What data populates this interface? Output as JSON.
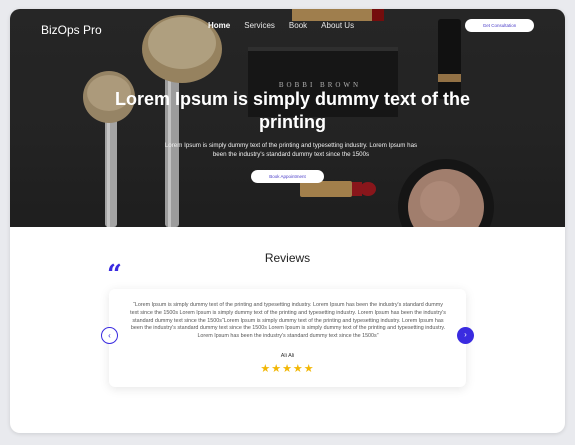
{
  "header": {
    "logo": "BizOps Pro",
    "nav": [
      "Home",
      "Services",
      "Book",
      "About Us"
    ],
    "cta_label": "Get Consultation"
  },
  "hero": {
    "title": "Lorem Ipsum is simply dummy text of the printing",
    "text": "Lorem Ipsum is simply dummy text of the printing and typesetting industry. Lorem Ipsum has been the industry's standard dummy text since the 1500s",
    "button_label": "Book Appointment",
    "image_brand": "BOBBI BROWN"
  },
  "reviews": {
    "title": "Reviews",
    "quote_glyph": "“",
    "text": "“Lorem Ipsum is simply dummy text of the printing and typesetting industry. Lorem Ipsum has been the industry's standard dummy text since the 1500s Lorem Ipsum is simply dummy text of the printing and typesetting industry. Lorem Ipsum has been the industry's standard dummy text since the 1500s“Lorem Ipsum is simply dummy text of the printing and typesetting industry. Lorem Ipsum has been the industry's standard dummy text since the 1500s Lorem Ipsum is simply dummy text of the printing and typesetting industry. Lorem Ipsum has been the industry's standard dummy text since the 1500s”",
    "reviewer": "Ali Ali",
    "stars": "★★★★★",
    "rating": 5,
    "prev_icon": "‹",
    "next_icon": "›"
  },
  "colors": {
    "accent": "#3a2be0",
    "star": "#f2b705"
  }
}
